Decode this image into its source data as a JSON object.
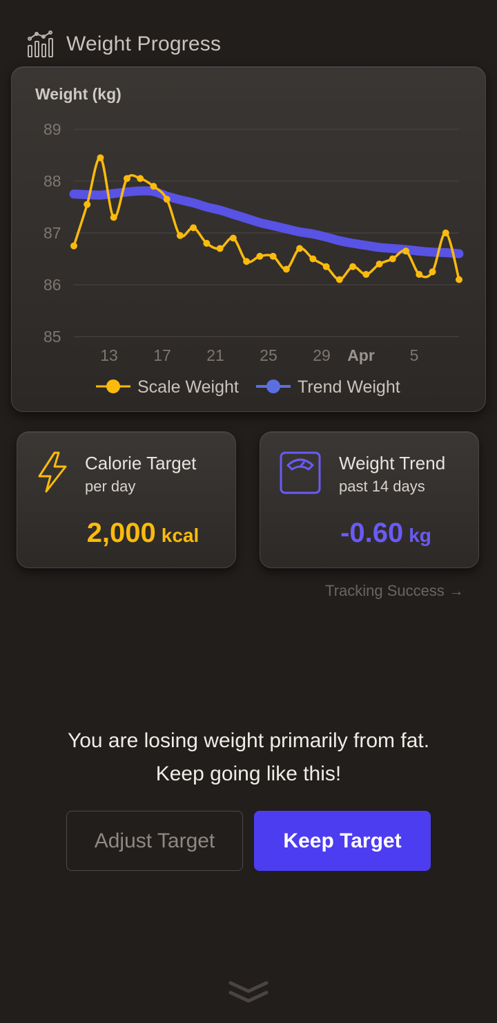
{
  "header": {
    "title": "Weight Progress",
    "icon": "bar-chart-icon"
  },
  "chart_data": {
    "type": "line",
    "ylabel": "Weight (kg)",
    "ylim": [
      85,
      89
    ],
    "yticks": [
      89,
      88,
      87,
      86,
      85
    ],
    "xticks": [
      "13",
      "17",
      "21",
      "25",
      "29",
      "Apr",
      "5"
    ],
    "grid": true,
    "legend_placement": "bottom",
    "series": [
      {
        "name": "Scale Weight",
        "color": "#fbbb0c",
        "values": [
          86.75,
          87.55,
          88.45,
          87.3,
          88.05,
          88.05,
          87.9,
          87.65,
          86.95,
          87.1,
          86.8,
          86.7,
          86.9,
          86.45,
          86.55,
          86.55,
          86.3,
          86.7,
          86.5,
          86.35,
          86.1,
          86.35,
          86.2,
          86.4,
          86.5,
          86.65,
          86.2,
          86.25,
          87.0,
          86.1
        ]
      },
      {
        "name": "Trend Weight",
        "color": "#5b55ee",
        "values": [
          87.75,
          87.74,
          87.73,
          87.76,
          87.79,
          87.81,
          87.8,
          87.71,
          87.64,
          87.58,
          87.5,
          87.44,
          87.36,
          87.28,
          87.2,
          87.14,
          87.08,
          87.02,
          86.98,
          86.92,
          86.85,
          86.8,
          86.76,
          86.72,
          86.7,
          86.68,
          86.65,
          86.63,
          86.62,
          86.6
        ]
      }
    ]
  },
  "calorie_card": {
    "title": "Calorie Target",
    "subtitle": "per day",
    "value": "2,000",
    "unit": "kcal",
    "icon": "lightning-icon"
  },
  "trend_card": {
    "title": "Weight Trend",
    "subtitle": "past 14 days",
    "value": "-0.60",
    "unit": "kg",
    "icon": "scale-icon"
  },
  "tracking_link": "Tracking Success →",
  "message": "You are losing weight primarily from fat. Keep going like this!",
  "buttons": {
    "adjust": "Adjust Target",
    "keep": "Keep Target"
  },
  "colors": {
    "accent_yellow": "#fbbb0c",
    "accent_purple": "#4d3df0",
    "background": "#221e1c"
  }
}
